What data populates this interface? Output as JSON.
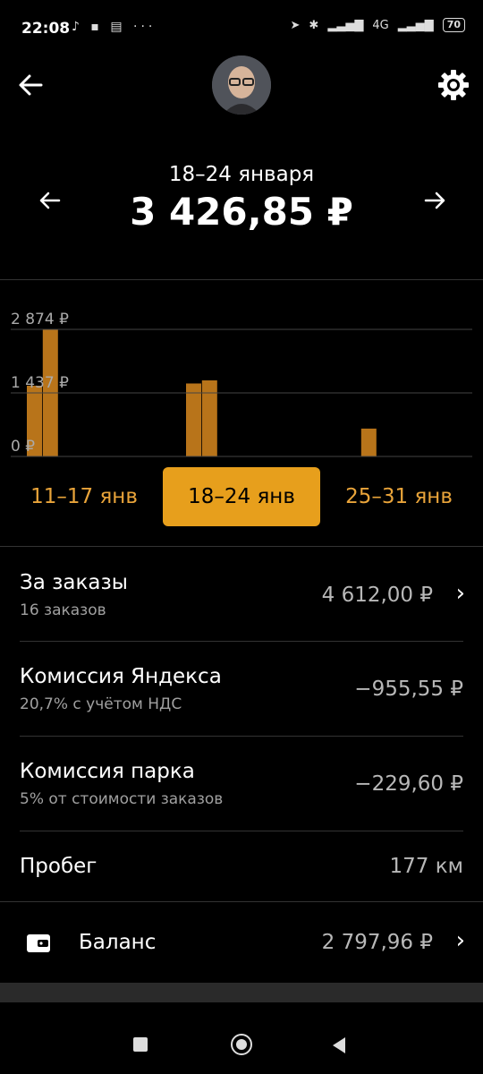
{
  "status_bar": {
    "time": "22:08",
    "left_icons": "♪ ▪ ▤ ···",
    "network": "4G",
    "battery": "70"
  },
  "header": {
    "back_icon": "arrow-left-icon",
    "settings_icon": "gear-icon"
  },
  "period": {
    "range": "18–24 января",
    "total": "3 426,85 ₽"
  },
  "chart": {
    "ticks": [
      "2 874 ₽",
      "1 437 ₽",
      "0 ₽"
    ]
  },
  "chart_data": {
    "type": "bar",
    "title": "",
    "y_ticks": [
      "2 874 ₽",
      "1 437 ₽",
      "0 ₽"
    ],
    "ylim": [
      0,
      2874
    ],
    "bar_color": "#b8741a",
    "values": [
      1600,
      2874,
      0,
      0,
      0,
      0,
      0,
      0,
      0,
      0,
      1650,
      1720,
      0,
      0,
      0,
      0,
      0,
      0,
      0,
      0,
      0,
      630
    ]
  },
  "weeks": [
    {
      "label": "11–17 янв",
      "active": false
    },
    {
      "label": "18–24 янв",
      "active": true
    },
    {
      "label": "25–31 янв",
      "active": false
    }
  ],
  "rows": {
    "orders": {
      "title": "За заказы",
      "sub": "16 заказов",
      "value": "4 612,00 ₽"
    },
    "yandex_fee": {
      "title": "Комиссия Яндекса",
      "sub": "20,7% с учётом НДС",
      "value": "−955,55 ₽"
    },
    "park_fee": {
      "title": "Комиссия парка",
      "sub": "5% от стоимости заказов",
      "value": "−229,60 ₽"
    },
    "mileage": {
      "title": "Пробег",
      "value": "177 км"
    },
    "balance": {
      "title": "Баланс",
      "value": "2 797,96 ₽"
    }
  },
  "colors": {
    "accent": "#e79f1c",
    "accent_text": "#e9a43a",
    "bar": "#b8741a"
  }
}
